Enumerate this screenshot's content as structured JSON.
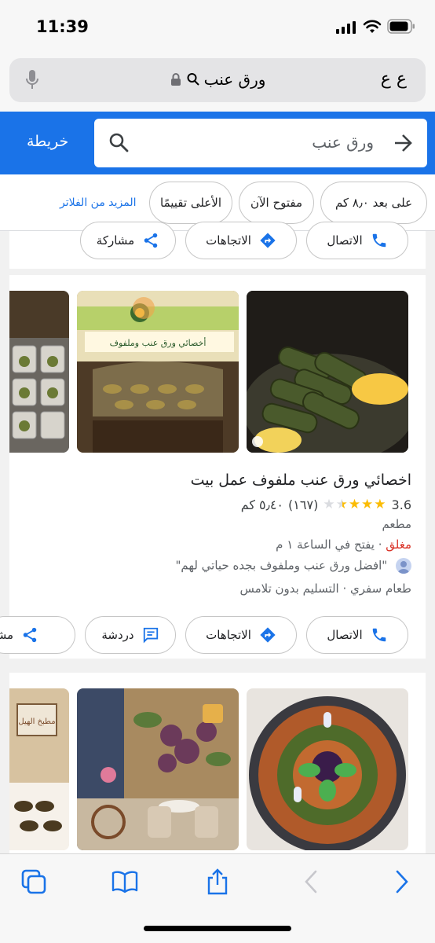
{
  "status": {
    "time": "11:39"
  },
  "browser": {
    "text_size_label": "ع ع",
    "url": "ورق عنب"
  },
  "maps_header": {
    "map_link": "خريطة",
    "search_query": "ورق عنب"
  },
  "filters": {
    "chips": [
      "على بعد ٨٫٠ كم",
      "مفتوح الآن",
      "الأعلى تقييمًا"
    ],
    "more": "المزيد من الفلاتر"
  },
  "top_card": {
    "actions": {
      "call": "الاتصال",
      "directions": "الاتجاهات",
      "share": "مشاركة"
    }
  },
  "listing": {
    "name": "اخصائي ورق عنب ملفوف عمل بيت",
    "rating": "3.6",
    "stars_filled": 3.5,
    "reviews": "(١٦٧)",
    "distance": "٥٫٤٠ كم",
    "category": "مطعم",
    "status_closed": "مغلق",
    "status_opens": "· يفتح في الساعة ١ م",
    "review_snippet": "\"افضل ورق عنب وملفوف بجده حياتي لهم\"",
    "services": "طعام سفري · التسليم بدون تلامس",
    "actions": {
      "call": "الاتصال",
      "directions": "الاتجاهات",
      "chat": "دردشة",
      "share_partial": "مشا"
    },
    "sign_text": "أخصائي ورق عنب وملفوف"
  },
  "next_listing": {
    "photo_sign": "مطبخ الهيل"
  },
  "colors": {
    "accent": "#1a73e8",
    "closed": "#d93025",
    "star": "#fbbc04"
  }
}
